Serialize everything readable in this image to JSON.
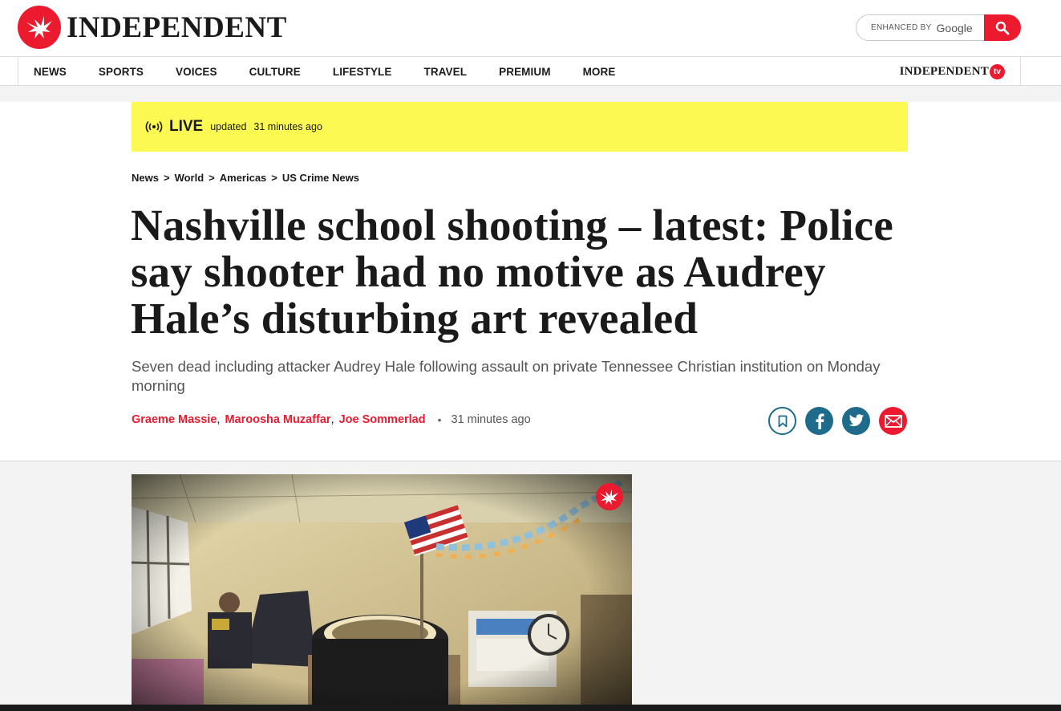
{
  "brand": {
    "name": "INDEPENDENT",
    "accent_color": "#ec1a2e"
  },
  "search": {
    "enhanced_by": "ENHANCED BY",
    "google": "Google",
    "button_icon": "search-icon"
  },
  "nav": {
    "items": [
      "NEWS",
      "SPORTS",
      "VOICES",
      "CULTURE",
      "LIFESTYLE",
      "TRAVEL",
      "PREMIUM",
      "MORE"
    ],
    "tv_label": "INDEPENDENT",
    "tv_badge": "tv"
  },
  "live": {
    "label": "LIVE",
    "updated": "updated",
    "time": "31 minutes ago",
    "background": "#fcf953"
  },
  "breadcrumb": [
    "News",
    "World",
    "Americas",
    "US Crime News"
  ],
  "article": {
    "headline": "Nashville school shooting – latest: Police say shooter had no motive as Audrey Hale’s disturbing art revealed",
    "standfirst": "Seven dead including attacker Audrey Hale following assault on private Tennessee Christian institution on Monday morning",
    "authors": [
      "Graeme Massie",
      "Maroosha Muzaffar",
      "Joe Sommerlad"
    ],
    "time": "31 minutes ago"
  },
  "share": {
    "icons": [
      "bookmark-icon",
      "facebook-icon",
      "twitter-icon",
      "email-icon"
    ],
    "colors": {
      "social": "#1e6b8c",
      "email": "#ec1a2e"
    }
  }
}
